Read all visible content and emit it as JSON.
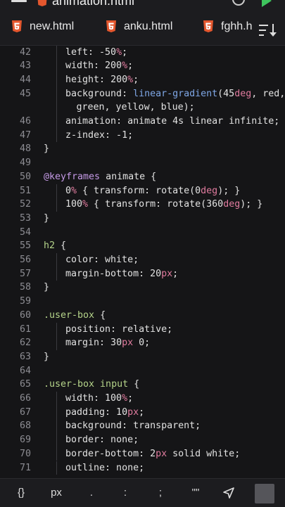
{
  "file_title": "animation.html",
  "tabs": [
    {
      "label": "new.html"
    },
    {
      "label": "anku.html"
    },
    {
      "label": "fghh.h"
    }
  ],
  "toolbar": {
    "k1": "{}",
    "k2": "px",
    "k3": ".",
    "k4": ":",
    "k5": ";",
    "k6": "\"\""
  },
  "lines": [
    {
      "n": "42",
      "indent": 2,
      "tokens": [
        [
          "prop",
          "left"
        ],
        [
          "punc",
          ": "
        ],
        [
          "num",
          "-50"
        ],
        [
          "unit",
          "%"
        ],
        [
          "punc",
          ";"
        ]
      ]
    },
    {
      "n": "43",
      "indent": 2,
      "tokens": [
        [
          "prop",
          "width"
        ],
        [
          "punc",
          ": "
        ],
        [
          "num",
          "200"
        ],
        [
          "unit",
          "%"
        ],
        [
          "punc",
          ";"
        ]
      ]
    },
    {
      "n": "44",
      "indent": 2,
      "tokens": [
        [
          "prop",
          "height"
        ],
        [
          "punc",
          ": "
        ],
        [
          "num",
          "200"
        ],
        [
          "unit",
          "%"
        ],
        [
          "punc",
          ";"
        ]
      ]
    },
    {
      "n": "45",
      "indent": 2,
      "tokens": [
        [
          "prop",
          "background"
        ],
        [
          "punc",
          ": "
        ],
        [
          "fn",
          "linear-gradient"
        ],
        [
          "punc",
          "(45"
        ],
        [
          "unit",
          "deg"
        ],
        [
          "punc",
          ", red,"
        ]
      ]
    },
    {
      "n": "",
      "indent": 3,
      "tokens": [
        [
          "punc",
          "green, yellow, blue);"
        ]
      ]
    },
    {
      "n": "46",
      "indent": 2,
      "tokens": [
        [
          "prop",
          "animation"
        ],
        [
          "punc",
          ": animate 4s linear infinite;"
        ]
      ]
    },
    {
      "n": "47",
      "indent": 2,
      "tokens": [
        [
          "prop",
          "z-index"
        ],
        [
          "punc",
          ": -1;"
        ]
      ]
    },
    {
      "n": "48",
      "indent": 0,
      "tokens": [
        [
          "punc",
          "}"
        ]
      ]
    },
    {
      "n": "49",
      "indent": 0,
      "tokens": []
    },
    {
      "n": "50",
      "indent": 0,
      "tokens": [
        [
          "kw",
          "@keyframes"
        ],
        [
          "punc",
          " animate {"
        ]
      ]
    },
    {
      "n": "51",
      "indent": 2,
      "tokens": [
        [
          "num",
          "0"
        ],
        [
          "unit",
          "%"
        ],
        [
          "punc",
          " { transform: rotate(0"
        ],
        [
          "unit",
          "deg"
        ],
        [
          "punc",
          "); }"
        ]
      ]
    },
    {
      "n": "52",
      "indent": 2,
      "tokens": [
        [
          "num",
          "100"
        ],
        [
          "unit",
          "%"
        ],
        [
          "punc",
          " { transform: rotate(360"
        ],
        [
          "unit",
          "deg"
        ],
        [
          "punc",
          "); }"
        ]
      ]
    },
    {
      "n": "53",
      "indent": 0,
      "tokens": [
        [
          "punc",
          "}"
        ]
      ]
    },
    {
      "n": "54",
      "indent": 0,
      "tokens": []
    },
    {
      "n": "55",
      "indent": 0,
      "tokens": [
        [
          "sel",
          "h2"
        ],
        [
          "punc",
          " {"
        ]
      ]
    },
    {
      "n": "56",
      "indent": 2,
      "tokens": [
        [
          "prop",
          "color"
        ],
        [
          "punc",
          ": white;"
        ]
      ]
    },
    {
      "n": "57",
      "indent": 2,
      "tokens": [
        [
          "prop",
          "margin-bottom"
        ],
        [
          "punc",
          ": 20"
        ],
        [
          "unit",
          "px"
        ],
        [
          "punc",
          ";"
        ]
      ]
    },
    {
      "n": "58",
      "indent": 0,
      "tokens": [
        [
          "punc",
          "}"
        ]
      ]
    },
    {
      "n": "59",
      "indent": 0,
      "tokens": []
    },
    {
      "n": "60",
      "indent": 0,
      "tokens": [
        [
          "sel",
          ".user-box"
        ],
        [
          "punc",
          " {"
        ]
      ]
    },
    {
      "n": "61",
      "indent": 2,
      "tokens": [
        [
          "prop",
          "position"
        ],
        [
          "punc",
          ": relative;"
        ]
      ]
    },
    {
      "n": "62",
      "indent": 2,
      "tokens": [
        [
          "prop",
          "margin"
        ],
        [
          "punc",
          ": 30"
        ],
        [
          "unit",
          "px"
        ],
        [
          "punc",
          " 0;"
        ]
      ]
    },
    {
      "n": "63",
      "indent": 0,
      "tokens": [
        [
          "punc",
          "}"
        ]
      ]
    },
    {
      "n": "64",
      "indent": 0,
      "tokens": []
    },
    {
      "n": "65",
      "indent": 0,
      "tokens": [
        [
          "sel",
          ".user-box input"
        ],
        [
          "punc",
          " {"
        ]
      ]
    },
    {
      "n": "66",
      "indent": 2,
      "tokens": [
        [
          "prop",
          "width"
        ],
        [
          "punc",
          ": "
        ],
        [
          "num",
          "100"
        ],
        [
          "unit",
          "%"
        ],
        [
          "punc",
          ";"
        ]
      ]
    },
    {
      "n": "67",
      "indent": 2,
      "tokens": [
        [
          "prop",
          "padding"
        ],
        [
          "punc",
          ": 10"
        ],
        [
          "unit",
          "px"
        ],
        [
          "punc",
          ";"
        ]
      ]
    },
    {
      "n": "68",
      "indent": 2,
      "tokens": [
        [
          "prop",
          "background"
        ],
        [
          "punc",
          ": transparent;"
        ]
      ]
    },
    {
      "n": "69",
      "indent": 2,
      "tokens": [
        [
          "prop",
          "border"
        ],
        [
          "punc",
          ": none;"
        ]
      ]
    },
    {
      "n": "70",
      "indent": 2,
      "tokens": [
        [
          "prop",
          "border-bottom"
        ],
        [
          "punc",
          ": 2"
        ],
        [
          "unit",
          "px"
        ],
        [
          "punc",
          " solid white;"
        ]
      ]
    },
    {
      "n": "71",
      "indent": 2,
      "tokens": [
        [
          "prop",
          "outline"
        ],
        [
          "punc",
          ": none;"
        ]
      ]
    }
  ]
}
